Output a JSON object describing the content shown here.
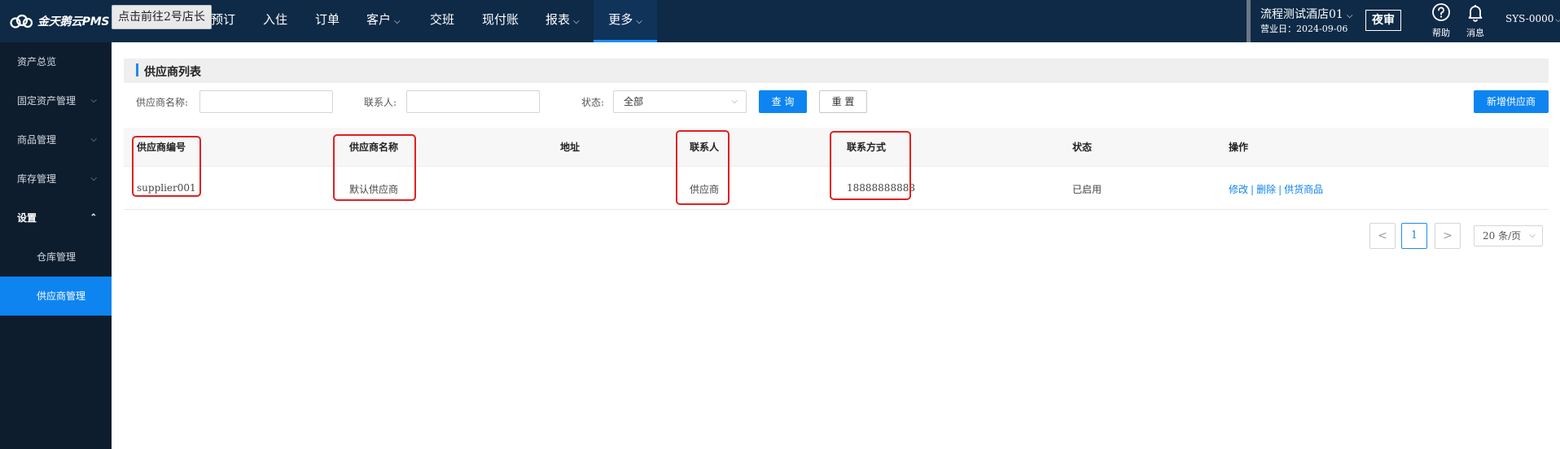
{
  "header": {
    "logo_text": "金天鹅云PMS",
    "tooltip": "点击前往2号店长",
    "nav": [
      {
        "label": "预订"
      },
      {
        "label": "入住"
      },
      {
        "label": "订单"
      },
      {
        "label": "客户"
      },
      {
        "label": "交班"
      },
      {
        "label": "现付账"
      },
      {
        "label": "报表"
      },
      {
        "label": "更多"
      }
    ],
    "hotel_name": "流程测试酒店01",
    "business_date": "营业日：2024-09-06",
    "night_audit": "夜审",
    "help": "帮助",
    "messages": "消息",
    "user": "SYS-0000",
    "icons": {
      "logo": "cloud-logo-icon",
      "help": "question-circle-icon",
      "messages": "bell-icon",
      "dropdown": "chevron-down-icon"
    }
  },
  "sidebar": {
    "items": [
      {
        "label": "资产总览"
      },
      {
        "label": "固定资产管理"
      },
      {
        "label": "商品管理"
      },
      {
        "label": "库存管理"
      },
      {
        "label": "设置"
      }
    ],
    "sub_items": [
      {
        "label": "仓库管理"
      },
      {
        "label": "供应商管理"
      }
    ]
  },
  "main": {
    "title": "供应商列表",
    "filters": {
      "supplier_name_label": "供应商名称:",
      "supplier_name_value": "",
      "contact_label": "联系人:",
      "contact_value": "",
      "status_label": "状态:",
      "status_value": "全部"
    },
    "buttons": {
      "query": "查 询",
      "reset": "重 置",
      "add": "新增供应商"
    },
    "table": {
      "columns": [
        "供应商编号",
        "供应商名称",
        "地址",
        "联系人",
        "联系方式",
        "状态",
        "操作"
      ],
      "rows": [
        {
          "code": "supplier001",
          "name": "默认供应商",
          "address": "",
          "contact": "供应商",
          "phone": "18888888888",
          "status": "已启用",
          "actions": [
            "修改",
            "删除",
            "供货商品"
          ]
        }
      ]
    },
    "pagination": {
      "prev": "<",
      "current_page": "1",
      "next": ">",
      "page_size": "20 条/页"
    }
  },
  "annotation_color": "#e02020",
  "accent_color": "#0e84f0"
}
